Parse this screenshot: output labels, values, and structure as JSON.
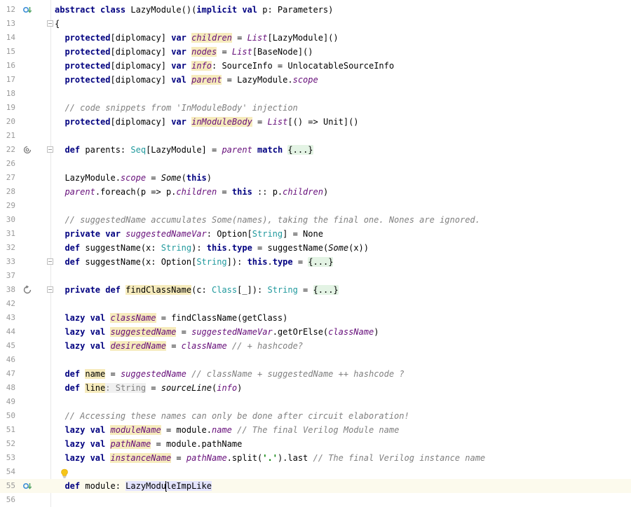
{
  "editor": {
    "lines": [
      {
        "no": "12",
        "tokens": [
          [
            "kw",
            "abstract class "
          ],
          [
            "",
            "LazyModule()("
          ],
          [
            "kw",
            "implicit val "
          ],
          [
            "",
            "p: Parameters)"
          ]
        ]
      },
      {
        "no": "13",
        "tokens": [
          [
            "",
            "{"
          ]
        ]
      },
      {
        "no": "14",
        "tokens": [
          [
            "",
            "  "
          ],
          [
            "kw",
            "protected"
          ],
          [
            "",
            "[diplomacy] "
          ],
          [
            "kw",
            "var "
          ],
          [
            "fld it decl",
            "children"
          ],
          [
            "",
            " = "
          ],
          [
            "fld it",
            "List"
          ],
          [
            "",
            "[LazyModule]()"
          ]
        ]
      },
      {
        "no": "15",
        "tokens": [
          [
            "",
            "  "
          ],
          [
            "kw",
            "protected"
          ],
          [
            "",
            "[diplomacy] "
          ],
          [
            "kw",
            "var "
          ],
          [
            "fld it decl",
            "nodes"
          ],
          [
            "",
            " = "
          ],
          [
            "fld it",
            "List"
          ],
          [
            "",
            "[BaseNode]()"
          ]
        ]
      },
      {
        "no": "16",
        "tokens": [
          [
            "",
            "  "
          ],
          [
            "kw",
            "protected"
          ],
          [
            "",
            "[diplomacy] "
          ],
          [
            "kw",
            "var "
          ],
          [
            "fld it decl",
            "info"
          ],
          [
            "",
            ": SourceInfo = UnlocatableSourceInfo"
          ]
        ]
      },
      {
        "no": "17",
        "tokens": [
          [
            "",
            "  "
          ],
          [
            "kw",
            "protected"
          ],
          [
            "",
            "[diplomacy] "
          ],
          [
            "kw",
            "val "
          ],
          [
            "fld it decl",
            "parent"
          ],
          [
            "",
            " = LazyModule."
          ],
          [
            "fld it",
            "scope"
          ]
        ]
      },
      {
        "no": "18",
        "tokens": []
      },
      {
        "no": "19",
        "tokens": [
          [
            "",
            "  "
          ],
          [
            "cm",
            "// code snippets from 'InModuleBody' injection"
          ]
        ]
      },
      {
        "no": "20",
        "tokens": [
          [
            "",
            "  "
          ],
          [
            "kw",
            "protected"
          ],
          [
            "",
            "[diplomacy] "
          ],
          [
            "kw",
            "var "
          ],
          [
            "fld it decl",
            "inModuleBody"
          ],
          [
            "",
            " = "
          ],
          [
            "fld it",
            "List"
          ],
          [
            "",
            "[() => Unit]()"
          ]
        ]
      },
      {
        "no": "21",
        "tokens": []
      },
      {
        "no": "22",
        "tokens": [
          [
            "",
            "  "
          ],
          [
            "kw",
            "def "
          ],
          [
            "",
            "parents: "
          ],
          [
            "ty",
            "Seq"
          ],
          [
            "",
            "[LazyModule] = "
          ],
          [
            "fld it",
            "parent"
          ],
          [
            "",
            " "
          ],
          [
            "kw",
            "match "
          ],
          [
            "folded",
            "{...}"
          ]
        ]
      },
      {
        "no": "26",
        "tokens": []
      },
      {
        "no": "27",
        "tokens": [
          [
            "",
            "  LazyModule."
          ],
          [
            "fld it",
            "scope"
          ],
          [
            "",
            " = "
          ],
          [
            "it",
            "Some"
          ],
          [
            "",
            "("
          ],
          [
            "kw",
            "this"
          ],
          [
            "",
            ")"
          ]
        ]
      },
      {
        "no": "28",
        "tokens": [
          [
            "",
            "  "
          ],
          [
            "fld it",
            "parent"
          ],
          [
            "",
            ".foreach(p => p."
          ],
          [
            "fld it",
            "children"
          ],
          [
            "",
            " = "
          ],
          [
            "kw",
            "this"
          ],
          [
            "",
            " :: p."
          ],
          [
            "fld it",
            "children"
          ],
          [
            "",
            ")"
          ]
        ]
      },
      {
        "no": "29",
        "tokens": []
      },
      {
        "no": "30",
        "tokens": [
          [
            "",
            "  "
          ],
          [
            "cm",
            "// suggestedName accumulates Some(names), taking the final one. Nones are ignored."
          ]
        ]
      },
      {
        "no": "31",
        "tokens": [
          [
            "",
            "  "
          ],
          [
            "kw",
            "private var "
          ],
          [
            "fld it",
            "suggestedNameVar"
          ],
          [
            "",
            ": Option["
          ],
          [
            "ty",
            "String"
          ],
          [
            "",
            "] = None"
          ]
        ]
      },
      {
        "no": "32",
        "tokens": [
          [
            "",
            "  "
          ],
          [
            "kw",
            "def "
          ],
          [
            "",
            "suggestName(x: "
          ],
          [
            "ty",
            "String"
          ],
          [
            "",
            "): "
          ],
          [
            "kw",
            "this"
          ],
          [
            "",
            "."
          ],
          [
            "kw",
            "type"
          ],
          [
            "",
            " = suggestName("
          ],
          [
            "it",
            "Some"
          ],
          [
            "",
            "(x))"
          ]
        ]
      },
      {
        "no": "33",
        "tokens": [
          [
            "",
            "  "
          ],
          [
            "kw",
            "def "
          ],
          [
            "",
            "suggestName(x: Option["
          ],
          [
            "ty",
            "String"
          ],
          [
            "",
            "]): "
          ],
          [
            "kw",
            "this"
          ],
          [
            "",
            "."
          ],
          [
            "kw",
            "type"
          ],
          [
            "",
            " = "
          ],
          [
            "folded",
            "{...}"
          ]
        ]
      },
      {
        "no": "37",
        "tokens": []
      },
      {
        "no": "38",
        "tokens": [
          [
            "",
            "  "
          ],
          [
            "kw",
            "private def "
          ],
          [
            "hl",
            "findClassName"
          ],
          [
            "",
            "(c: "
          ],
          [
            "ty",
            "Class"
          ],
          [
            "",
            "[_]): "
          ],
          [
            "ty",
            "String"
          ],
          [
            "",
            " = "
          ],
          [
            "folded",
            "{...}"
          ]
        ]
      },
      {
        "no": "42",
        "tokens": []
      },
      {
        "no": "43",
        "tokens": [
          [
            "",
            "  "
          ],
          [
            "kw",
            "lazy val "
          ],
          [
            "fld it decl",
            "className"
          ],
          [
            "",
            " = findClassName(getClass)"
          ]
        ]
      },
      {
        "no": "44",
        "tokens": [
          [
            "",
            "  "
          ],
          [
            "kw",
            "lazy val "
          ],
          [
            "fld it decl",
            "suggestedName"
          ],
          [
            "",
            " = "
          ],
          [
            "fld it",
            "suggestedNameVar"
          ],
          [
            "",
            ".getOrElse("
          ],
          [
            "fld it",
            "className"
          ],
          [
            "",
            ")"
          ]
        ]
      },
      {
        "no": "45",
        "tokens": [
          [
            "",
            "  "
          ],
          [
            "kw",
            "lazy val "
          ],
          [
            "fld it decl",
            "desiredName"
          ],
          [
            "",
            " = "
          ],
          [
            "fld it",
            "className"
          ],
          [
            "",
            " "
          ],
          [
            "cm",
            "// + hashcode?"
          ]
        ]
      },
      {
        "no": "46",
        "tokens": []
      },
      {
        "no": "47",
        "tokens": [
          [
            "",
            "  "
          ],
          [
            "kw",
            "def "
          ],
          [
            "decl",
            "name"
          ],
          [
            "",
            " = "
          ],
          [
            "fld it",
            "suggestedName"
          ],
          [
            "",
            " "
          ],
          [
            "cm",
            "// className + suggestedName ++ hashcode ?"
          ]
        ]
      },
      {
        "no": "48",
        "tokens": [
          [
            "",
            "  "
          ],
          [
            "kw",
            "def "
          ],
          [
            "decl",
            "line"
          ],
          [
            "hint",
            ": String"
          ],
          [
            "",
            " = "
          ],
          [
            "it",
            "sourceLine"
          ],
          [
            "",
            "("
          ],
          [
            "fld it",
            "info"
          ],
          [
            "",
            ")"
          ]
        ]
      },
      {
        "no": "49",
        "tokens": []
      },
      {
        "no": "50",
        "tokens": [
          [
            "",
            "  "
          ],
          [
            "cm",
            "// Accessing these names can only be done after circuit elaboration!"
          ]
        ]
      },
      {
        "no": "51",
        "tokens": [
          [
            "",
            "  "
          ],
          [
            "kw",
            "lazy val "
          ],
          [
            "fld it decl",
            "moduleName"
          ],
          [
            "",
            " = module."
          ],
          [
            "fld it",
            "name"
          ],
          [
            "",
            " "
          ],
          [
            "cm",
            "// The final Verilog Module name"
          ]
        ]
      },
      {
        "no": "52",
        "tokens": [
          [
            "",
            "  "
          ],
          [
            "kw",
            "lazy val "
          ],
          [
            "fld it decl",
            "pathName"
          ],
          [
            "",
            " = module.pathName"
          ]
        ]
      },
      {
        "no": "53",
        "tokens": [
          [
            "",
            "  "
          ],
          [
            "kw",
            "lazy val "
          ],
          [
            "fld it decl",
            "instanceName"
          ],
          [
            "",
            " = "
          ],
          [
            "fld it",
            "pathName"
          ],
          [
            "",
            ".split("
          ],
          [
            "str",
            "'.'"
          ],
          [
            "",
            ").last "
          ],
          [
            "cm",
            "// The final Verilog instance name"
          ]
        ]
      },
      {
        "no": "54",
        "tokens": []
      },
      {
        "no": "55",
        "tokens": [
          [
            "",
            "  "
          ],
          [
            "kw",
            "def "
          ],
          [
            "",
            "module: "
          ],
          [
            "sel",
            "LazyModu"
          ],
          [
            "caret",
            ""
          ],
          [
            "sel",
            "leImpLike"
          ]
        ]
      },
      {
        "no": "56",
        "tokens": []
      }
    ],
    "gutter_icons": {
      "12": "implementing-icon",
      "22": "recursion-icon",
      "38": "recursive-call-icon",
      "55": "implementing-icon"
    },
    "fold_markers": [
      "13",
      "22",
      "33",
      "38"
    ],
    "current_line": "55"
  }
}
